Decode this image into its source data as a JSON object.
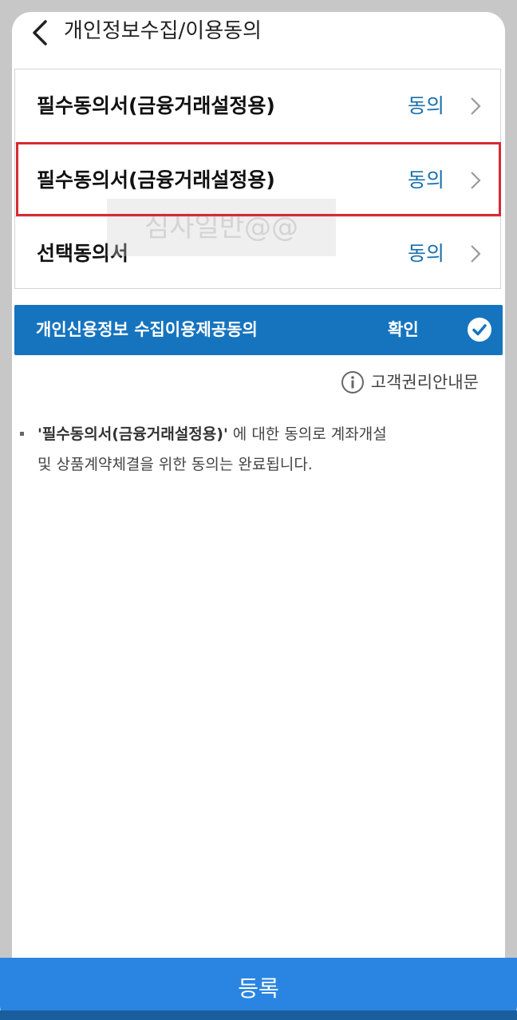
{
  "header": {
    "title": "개인정보수집/이용동의",
    "back_icon": "chevron-left-icon"
  },
  "consents": [
    {
      "label": "필수동의서(금융거래설정용)",
      "status": "동의"
    },
    {
      "label": "필수동의서(금융거래설정용)",
      "status": "동의"
    },
    {
      "label": "선택동의서",
      "status": "동의"
    }
  ],
  "watermark": "심사일반@@",
  "credit_consent": {
    "label": "개인신용정보 수집이용제공동의",
    "status": "확인",
    "checked": true
  },
  "rights_link": "고객권리안내문",
  "notice": {
    "quote": "'필수동의서(금융거래설정용)'",
    "text_1": " 에 대한 동의로 계좌개설",
    "text_2": "및 상품계약체결을 위한 동의는 완료됩니다."
  },
  "register_button": "등록",
  "colors": {
    "accent_blue": "#1674bf",
    "status_text": "#1a6fae",
    "highlight_red": "#d62b33",
    "register_blue": "#2a85e2"
  }
}
